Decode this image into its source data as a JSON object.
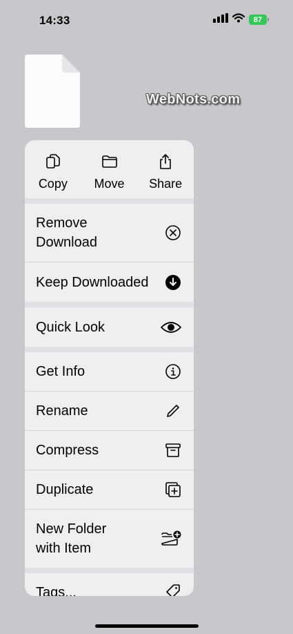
{
  "status_bar": {
    "time": "14:33",
    "battery": "87"
  },
  "watermark": "WebNots.com",
  "top_actions": [
    {
      "label": "Copy",
      "icon": "copy-icon"
    },
    {
      "label": "Move",
      "icon": "folder-icon"
    },
    {
      "label": "Share",
      "icon": "share-icon"
    }
  ],
  "menu": {
    "remove_download": "Remove\nDownload",
    "keep_downloaded": "Keep Downloaded",
    "quick_look": "Quick Look",
    "get_info": "Get Info",
    "rename": "Rename",
    "compress": "Compress",
    "duplicate": "Duplicate",
    "new_folder": "New Folder\nwith Item",
    "tags": "Tags..."
  },
  "colors": {
    "battery": "#34c759",
    "menu_bg": "#efeff2",
    "backdrop": "#c8c7cc"
  }
}
